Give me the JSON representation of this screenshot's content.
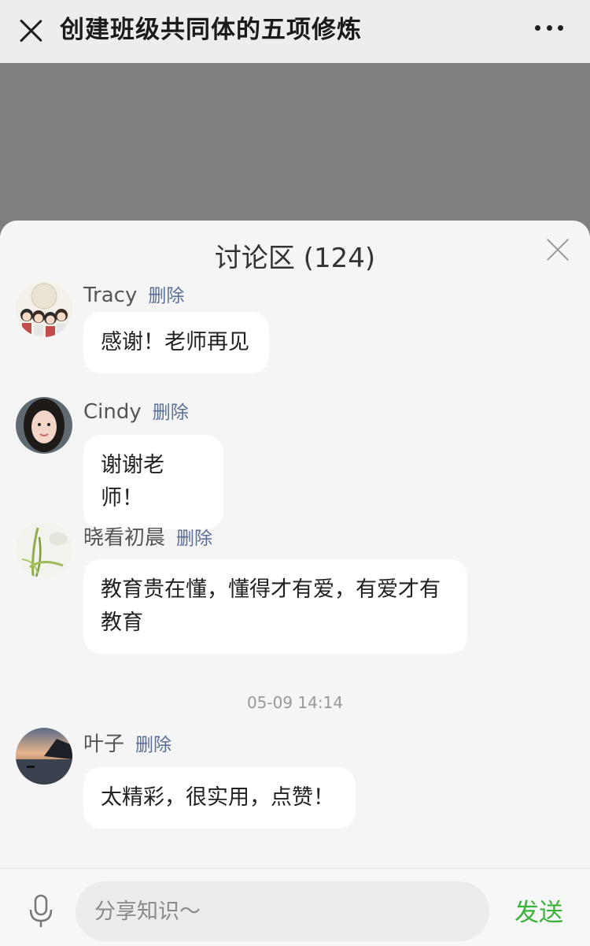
{
  "nav": {
    "title": "创建班级共同体的五项修炼"
  },
  "discussion": {
    "title": "讨论区 (124)",
    "comments": [
      {
        "author": "Tracy",
        "delete_label": "删除",
        "text": "感谢！老师再见",
        "avatar": "cartoon-group-avatar"
      },
      {
        "author": "Cindy",
        "delete_label": "删除",
        "text": "谢谢老师！",
        "avatar": "girl-portrait-avatar"
      },
      {
        "author": "晓看初晨",
        "delete_label": "删除",
        "text_line1": "教育贵在懂，懂得才有爱，有爱才有",
        "text_line2": "教育",
        "avatar": "plant-avatar"
      },
      {
        "author": "叶子",
        "delete_label": "删除",
        "text": "太精彩，很实用，点赞！",
        "avatar": "sunset-sea-avatar"
      }
    ],
    "timestamp": "05-09 14:14"
  },
  "input_bar": {
    "placeholder": "分享知识～",
    "send_label": "发送"
  },
  "colors": {
    "send": "#3bb23c",
    "delete_link": "#5a6f98",
    "overlay": "#7f7f7f"
  }
}
